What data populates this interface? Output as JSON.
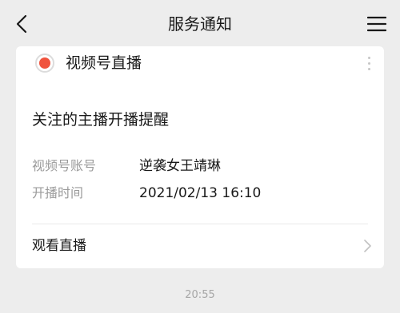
{
  "nav": {
    "title": "服务通知",
    "back_icon": "chevron-left-icon",
    "menu_icon": "hamburger-menu-icon"
  },
  "card": {
    "source": {
      "name": "视频号直播",
      "icon": "live-record-icon",
      "icon_color": "#f0533d"
    },
    "more_icon": "more-vertical-icon",
    "title": "关注的主播开播提醒",
    "fields": [
      {
        "label": "视频号账号",
        "value": "逆袭女王靖琳"
      },
      {
        "label": "开播时间",
        "value": "2021/02/13 16:10"
      }
    ],
    "action": {
      "label": "观看直播",
      "icon": "chevron-right-icon"
    }
  },
  "timestamp": "20:55",
  "colors": {
    "background": "#ededed",
    "card": "#ffffff",
    "text": "#191919",
    "muted": "#9b9b9b",
    "accent": "#f0533d"
  }
}
